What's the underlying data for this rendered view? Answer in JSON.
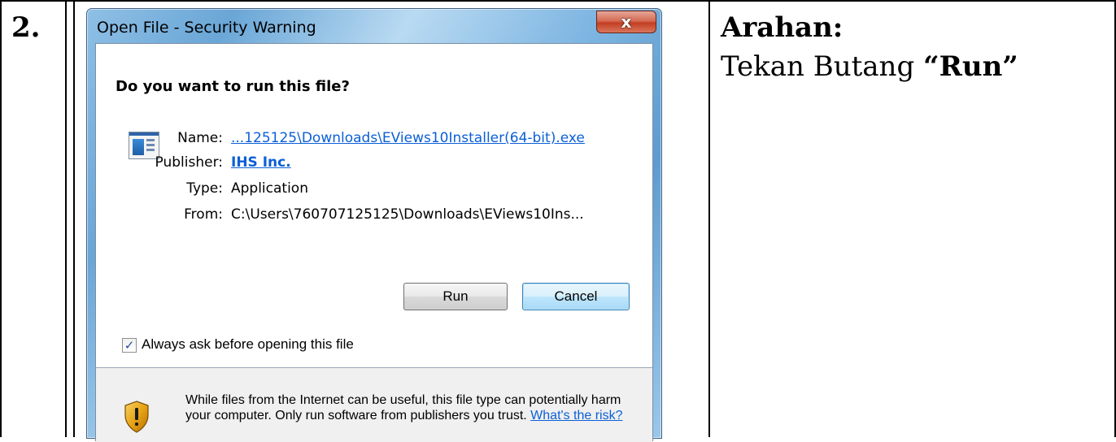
{
  "step": {
    "number": "2."
  },
  "instruction": {
    "title": "Arahan:",
    "prefix": "Tekan Butang ",
    "button_ref": "“Run”"
  },
  "dialog": {
    "title": "Open File - Security Warning",
    "close_label": "x",
    "question": "Do you want to run this file?",
    "fields": {
      "name_label": "Name:",
      "name_value": "...125125\\Downloads\\EViews10Installer(64-bit).exe",
      "publisher_label": "Publisher:",
      "publisher_value": "IHS Inc.",
      "type_label": "Type:",
      "type_value": "Application",
      "from_label": "From:",
      "from_value": "C:\\Users\\760707125125\\Downloads\\EViews10Ins..."
    },
    "buttons": {
      "run": "Run",
      "cancel": "Cancel"
    },
    "checkbox": {
      "label": "Always ask before opening this file",
      "checked": true
    },
    "warning": {
      "text": "While files from the Internet can be useful, this file type can potentially harm your computer. Only run software from publishers you trust. ",
      "link": "What's the risk?"
    },
    "icons": {
      "file": "application-icon",
      "warning": "shield-warning-icon"
    }
  }
}
